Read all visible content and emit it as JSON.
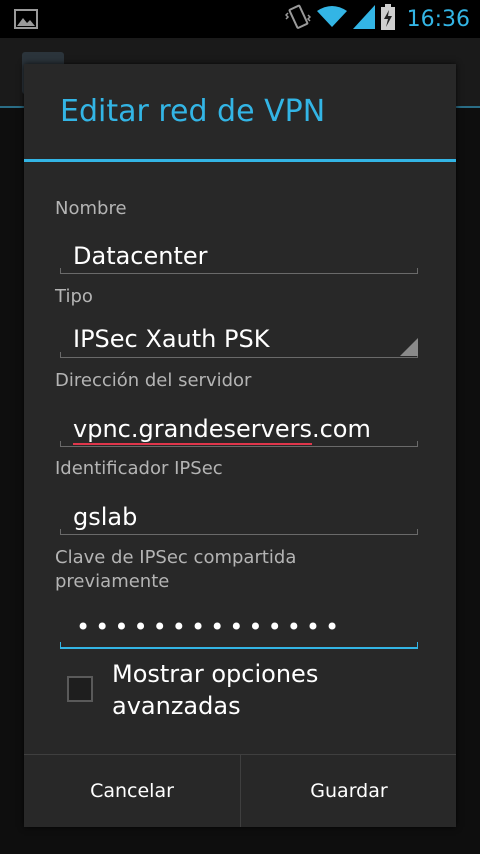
{
  "status_bar": {
    "time": "16:36",
    "icons": [
      "image-notification-icon",
      "vibrate-icon",
      "wifi-icon",
      "signal-icon",
      "battery-charging-icon"
    ]
  },
  "dialog": {
    "title": "Editar red de VPN",
    "fields": {
      "name": {
        "label": "Nombre",
        "value": "Datacenter"
      },
      "type": {
        "label": "Tipo",
        "value": "IPSec Xauth PSK"
      },
      "server": {
        "label": "Dirección del servidor",
        "value_prefix": "vpnc.grandeservers",
        "value_suffix": ".com"
      },
      "ipsec_id": {
        "label": "Identificador IPSec",
        "value": "gslab"
      },
      "psk": {
        "label": "Clave de IPSec compartida previamente",
        "value": "••••••••••••••"
      }
    },
    "advanced": {
      "label": "Mostrar opciones avanzadas",
      "checked": false
    },
    "buttons": {
      "cancel": "Cancelar",
      "save": "Guardar"
    }
  },
  "colors": {
    "accent": "#33b5e5",
    "dialog_bg": "#282828",
    "spell_error": "#e0364b"
  }
}
